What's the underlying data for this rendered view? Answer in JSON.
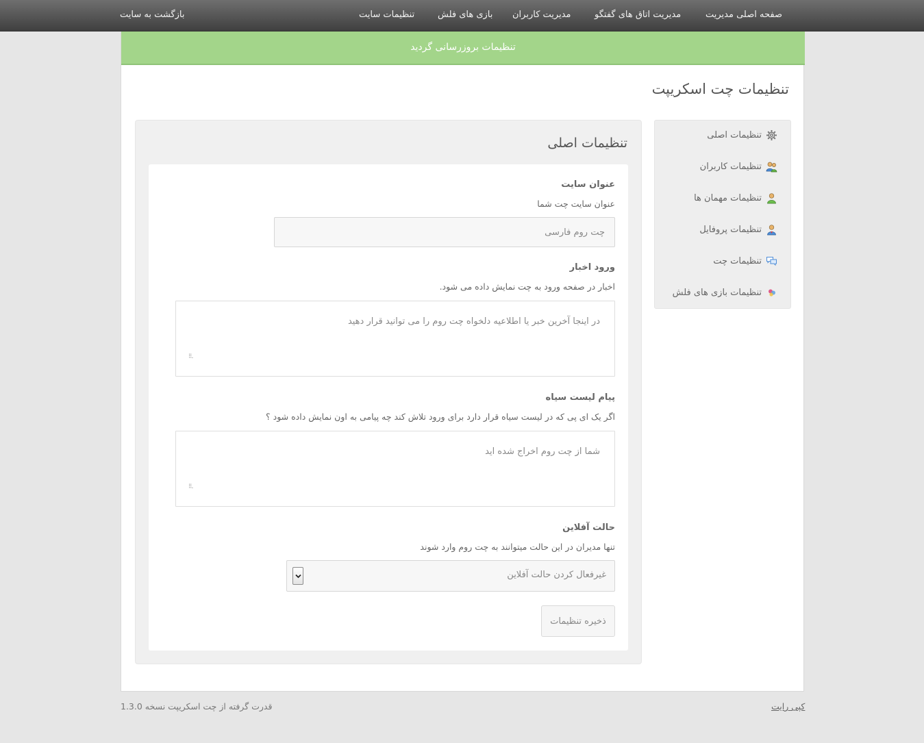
{
  "topnav": {
    "back_to_site": "بازگشت به سایت",
    "items": [
      {
        "label": "صفحه اصلی مدیریت"
      },
      {
        "label": "مدیریت اتاق های گفتگو"
      },
      {
        "label": "مدیریت کاربران"
      },
      {
        "label": "بازی های فلش"
      },
      {
        "label": "تنظیمات سایت"
      }
    ]
  },
  "alert": {
    "message": "تنظیمات بروزرسانی گردید",
    "color": "#a3d58a"
  },
  "page": {
    "title": "تنظیمات چت اسکریپت"
  },
  "sidebar": {
    "items": [
      {
        "label": "تنظیمات اصلی",
        "icon": "gear-icon"
      },
      {
        "label": "تنظیمات کاربران",
        "icon": "users-icon"
      },
      {
        "label": "تنظیمات مهمان ها",
        "icon": "guest-user-icon"
      },
      {
        "label": "تنظیمات پروفایل",
        "icon": "profile-user-icon"
      },
      {
        "label": "تنظیمات چت",
        "icon": "chat-bubbles-icon"
      },
      {
        "label": "تنظیمات بازی های فلش",
        "icon": "flash-games-icon"
      }
    ]
  },
  "main": {
    "title": "تنظیمات اصلی",
    "fields": {
      "site_title": {
        "label": "عنوان سایت",
        "help": "عنوان سایت چت شما",
        "placeholder": "چت روم فارسی"
      },
      "news": {
        "label": "ورود اخبار",
        "help": "اخبار در صفحه ورود به چت نمایش داده می شود.",
        "placeholder": "در اینجا آخرین خبر یا اطلاعیه دلخواه چت روم را می توانید قرار دهید"
      },
      "blacklist": {
        "label": "پیام لیست سیاه",
        "help": "اگر یک ای پی که در لیست سیاه قرار دارد برای ورود تلاش کند چه پیامی به اون نمایش داده شود ؟",
        "placeholder": "شما از چت روم اخراج شده اید"
      },
      "offline": {
        "label": "حالت آفلاین",
        "help": "تنها مدیران در این حالت میتوانند به چت روم وارد شوند",
        "selected": "غیرفعال کردن حالت آفلاین"
      }
    },
    "save_label": "ذخیره تنظیمات"
  },
  "footer": {
    "powered_by": "قدرت گرفته از چت اسکریپت نسخه 1.3.0",
    "copyright": "کپی رایت"
  }
}
